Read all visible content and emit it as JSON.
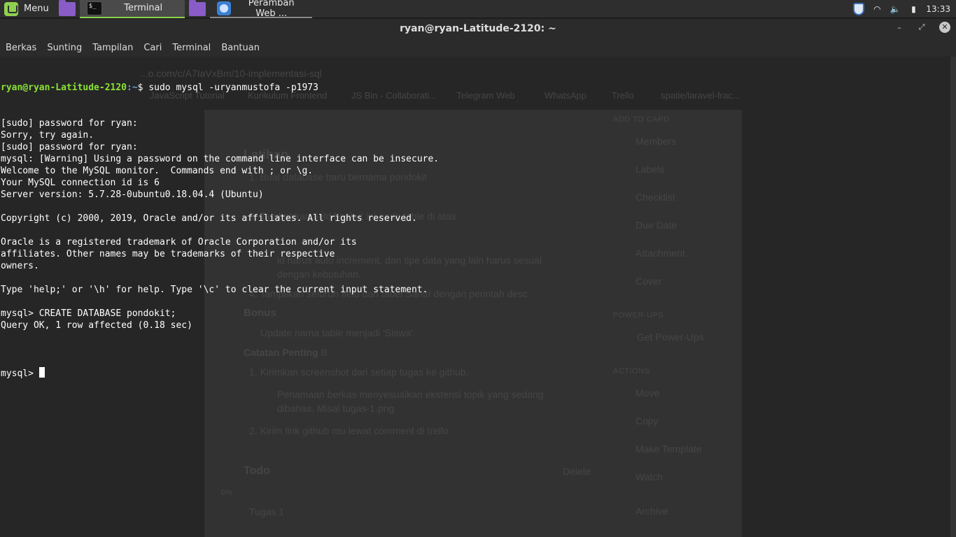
{
  "panel": {
    "menu_label": "Menu",
    "tasks": [
      {
        "label": "Terminal",
        "icon": "terminal-icon"
      },
      {
        "label": "Peramban Web ...",
        "icon": "browser-icon"
      }
    ],
    "clock": "13:33",
    "tray_icons": [
      "shield-icon",
      "wifi-icon",
      "volume-icon",
      "battery-icon"
    ],
    "accent": "#8fd14f"
  },
  "window": {
    "title": "ryan@ryan-Latitude-2120: ~",
    "controls": {
      "minimize": "–",
      "maximize": "⤢",
      "close": "✕"
    }
  },
  "menubar": [
    "Berkas",
    "Sunting",
    "Tampilan",
    "Cari",
    "Terminal",
    "Bantuan"
  ],
  "terminal": {
    "prompt_user": "ryan@ryan-Latitude-2120",
    "prompt_path": ":~",
    "command": "$ sudo mysql -uryanmustofa -p1973",
    "lines": [
      "[sudo] password for ryan:",
      "Sorry, try again.",
      "[sudo] password for ryan:",
      "mysql: [Warning] Using a password on the command line interface can be insecure.",
      "Welcome to the MySQL monitor.  Commands end with ; or \\g.",
      "Your MySQL connection id is 6",
      "Server version: 5.7.28-0ubuntu0.18.04.4 (Ubuntu)",
      "",
      "Copyright (c) 2000, 2019, Oracle and/or its affiliates. All rights reserved.",
      "",
      "Oracle is a registered trademark of Oracle Corporation and/or its",
      "affiliates. Other names may be trademarks of their respective",
      "owners.",
      "",
      "Type 'help;' or '\\h' for help. Type '\\c' to clear the current input statement.",
      "",
      "mysql> CREATE DATABASE pondokit;",
      "Query OK, 1 row affected (0.18 sec)",
      ""
    ],
    "current_prompt": "mysql> "
  },
  "background": {
    "url": "...o.com/c/A7IaVxBm/10-implementasi-sql",
    "bookmarks": [
      "JavaScript Tutorial",
      "Kurikulum Frontend",
      "JS Bin - Collaborati...",
      "Telegram Web",
      "WhatsApp",
      "Trello",
      "spatie/laravel-frac..."
    ],
    "card_heading": "Latihan",
    "card_lines": [
      "1. Buat database baru bernama pondokit",
      "3. Tambahkan field berikut ini pada table di atas",
      "id harus auto increment, dan tipe data yang lain harus sesuai",
      "dengan kebutuhan.",
      "4. Tampilkan seluruh field dari tabel Santri dengan perintah desc",
      "Bonus",
      "Update nama table menjadi 'Siswa'.",
      "Catatan Penting !!",
      "1. Kirimkan screenshot dari setiap tugas ke github.",
      "Penamaan berkas menyesuaikan ekstensi topik yang sedang",
      "dibahas. Misal tugas-1.png",
      "2. Kirim link github mu lewat comment di trello",
      "Todo",
      "Tugas 1"
    ],
    "sidebar_sections": [
      "ADD TO CARD",
      "POWER-UPS",
      "ACTIONS"
    ],
    "sidebar_items": [
      "Members",
      "Labels",
      "Checklist",
      "Due Date",
      "Attachment",
      "Cover",
      "Get Power-Ups",
      "Move",
      "Copy",
      "Make Template",
      "Watch",
      "Archive"
    ],
    "delete_label": "Delete",
    "progress": "0%"
  }
}
